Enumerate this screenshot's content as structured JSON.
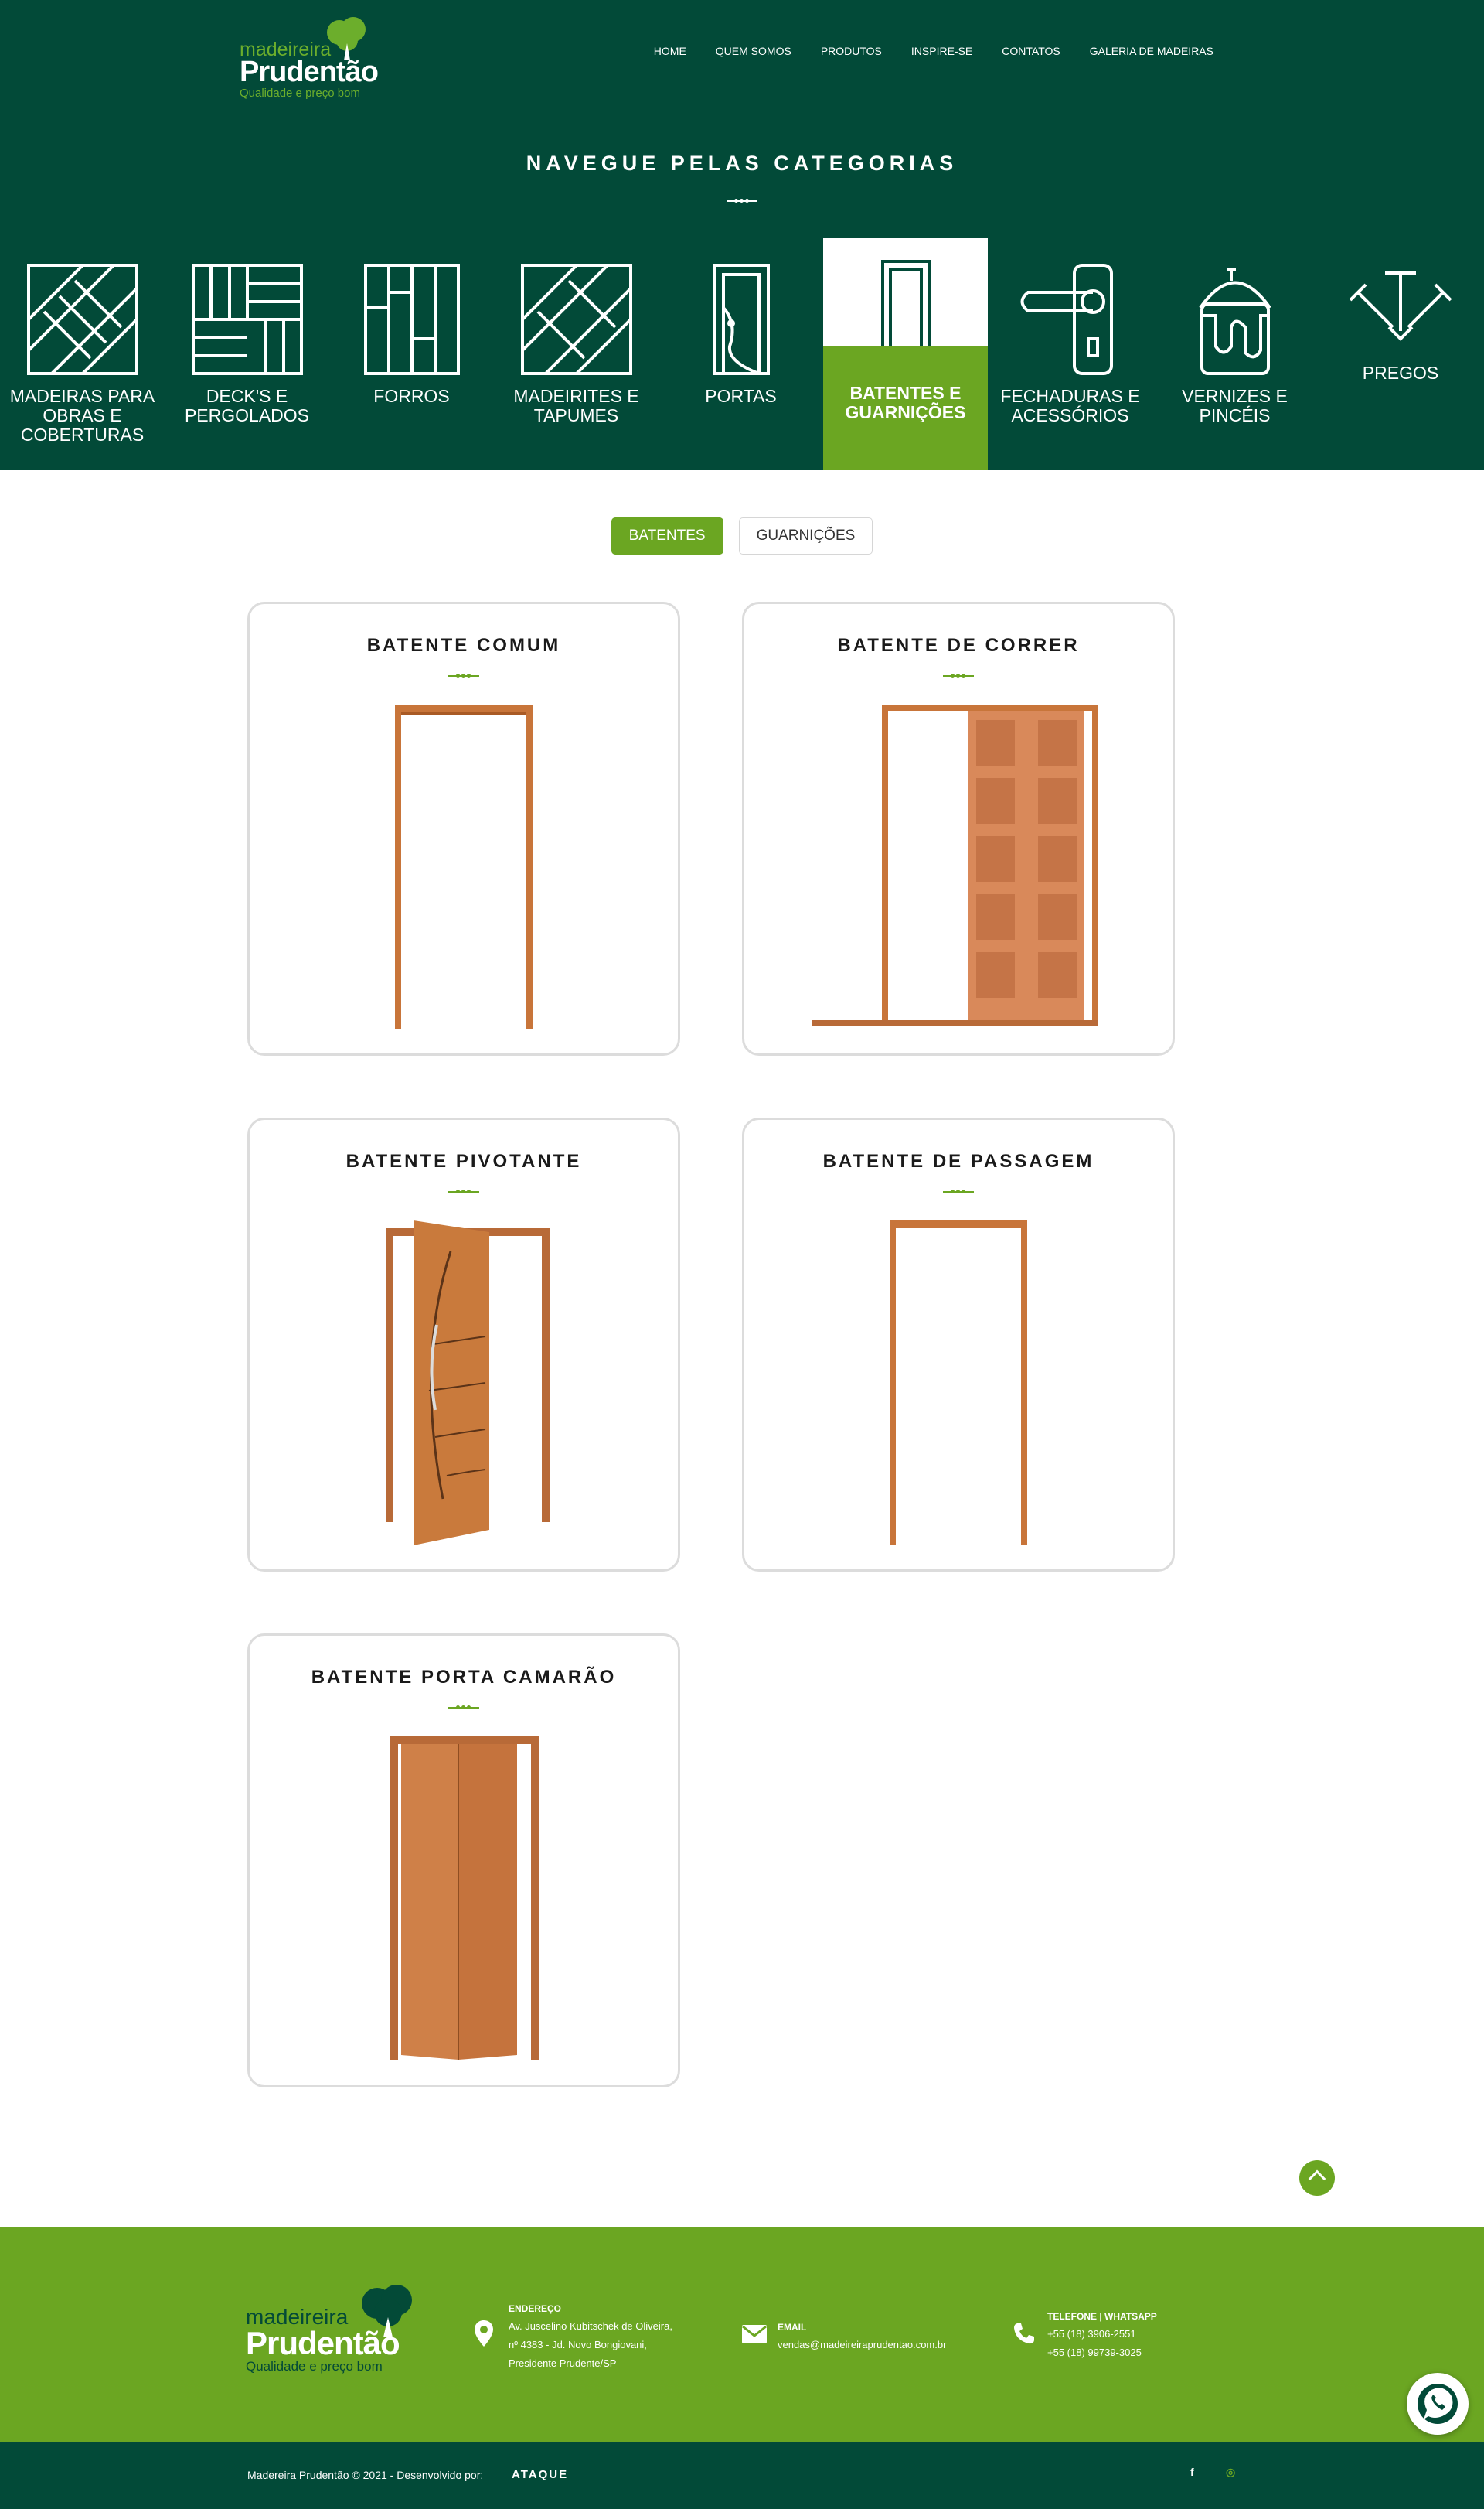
{
  "header": {
    "logo": {
      "line1": "madeireira",
      "line2": "Prudentão",
      "tagline": "Qualidade e preço bom"
    },
    "nav": [
      "HOME",
      "QUEM SOMOS",
      "PRODUTOS",
      "INSPIRE-SE",
      "CONTATOS",
      "GALERIA DE MADEIRAS"
    ]
  },
  "categories": {
    "title": "NAVEGUE PELAS CATEGORIAS",
    "items": [
      {
        "label": "MADEIRAS PARA OBRAS E COBERTURAS",
        "icon": "diagonal-boards-icon"
      },
      {
        "label": "DECK'S E PERGOLADOS",
        "icon": "deck-icon"
      },
      {
        "label": "FORROS",
        "icon": "ceiling-planks-icon"
      },
      {
        "label": "MADEIRITES E TAPUMES",
        "icon": "plywood-icon"
      },
      {
        "label": "PORTAS",
        "icon": "door-icon"
      },
      {
        "label": "BATENTES E GUARNIÇÕES",
        "icon": "door-frame-icon",
        "active": true
      },
      {
        "label": "FECHADURAS E ACESSÓRIOS",
        "icon": "door-handle-icon"
      },
      {
        "label": "VERNIZES E PINCÉIS",
        "icon": "paint-can-icon"
      },
      {
        "label": "PREGOS",
        "icon": "nails-icon"
      }
    ]
  },
  "tabs": [
    {
      "label": "BATENTES",
      "active": true
    },
    {
      "label": "GUARNIÇÕES",
      "active": false
    }
  ],
  "products": [
    {
      "title": "BATENTE COMUM",
      "image": "door-frame-plain"
    },
    {
      "title": "BATENTE DE CORRER",
      "image": "sliding-door-frame"
    },
    {
      "title": "BATENTE PIVOTANTE",
      "image": "pivot-door"
    },
    {
      "title": "BATENTE DE PASSAGEM",
      "image": "passage-frame"
    },
    {
      "title": "BATENTE PORTA CAMARÃO",
      "image": "folding-door"
    }
  ],
  "footer": {
    "logo": {
      "line1": "madeireira",
      "line2": "Prudentão",
      "tagline": "Qualidade e preço bom"
    },
    "address": {
      "heading": "ENDEREÇO",
      "lines": [
        "Av. Juscelino Kubitschek de Oliveira,",
        "nº 4383 - Jd. Novo Bongiovani,",
        "Presidente Prudente/SP"
      ]
    },
    "email": {
      "heading": "EMAIL",
      "value": "vendas@madeireiraprudentao.com.br"
    },
    "phone": {
      "heading": "TELEFONE | WHATSAPP",
      "lines": [
        "+55 (18) 3906-2551",
        "+55 (18) 99739-3025"
      ]
    },
    "copyright": "Madereira Prudentão © 2021 - Desenvolvido por:",
    "developer": "ATAQUE",
    "social": [
      "f",
      "◎"
    ]
  },
  "colors": {
    "dark_green": "#024a38",
    "light_green": "#6ba622",
    "wood": "#c8753a"
  }
}
